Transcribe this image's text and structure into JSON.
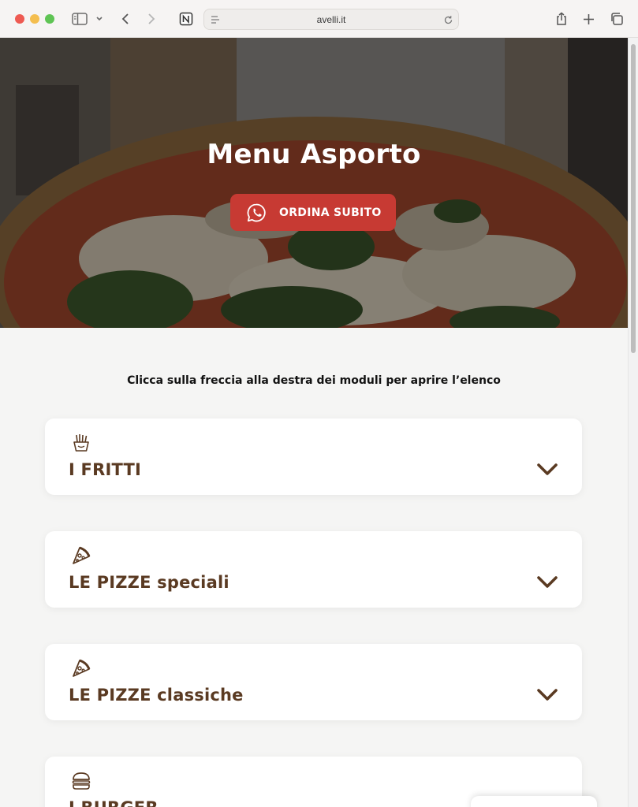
{
  "browser": {
    "url": "avelli.it"
  },
  "hero": {
    "title": "Menu Asporto",
    "order_button": "ORDINA SUBITO"
  },
  "instruction": "Clicca sulla freccia alla destra dei moduli per aprire l’elenco",
  "categories": [
    {
      "label": "I FRITTI",
      "icon": "fries-icon"
    },
    {
      "label": "LE PIZZE speciali",
      "icon": "pizza-slice-icon"
    },
    {
      "label": "LE PIZZE classiche",
      "icon": "pizza-slice-icon"
    },
    {
      "label": "I BURGER",
      "icon": "burger-icon"
    }
  ],
  "colors": {
    "accent_red": "#c73a33",
    "brown_text": "#5a3a22",
    "page_bg": "#f5f5f4"
  }
}
